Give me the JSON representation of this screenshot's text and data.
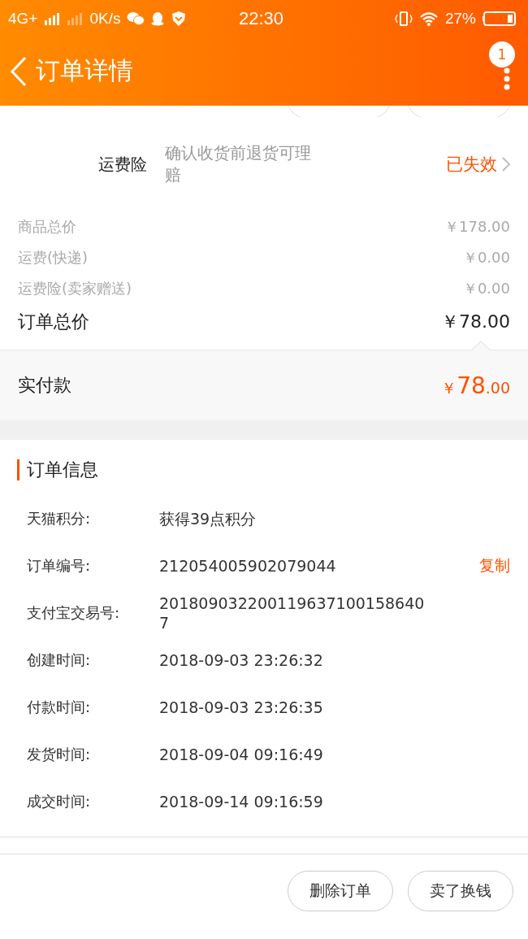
{
  "status_bar": {
    "network": "4G+",
    "speed": "0K/s",
    "time": "22:30",
    "battery": "27%"
  },
  "header": {
    "title": "订单详情",
    "badge": "1"
  },
  "insurance": {
    "label": "运费险",
    "description": "确认收货前退货可理赔",
    "status": "已失效"
  },
  "prices": [
    {
      "label": "商品总价",
      "value": "￥178.00",
      "kind": "minor"
    },
    {
      "label": "运费(快递)",
      "value": "￥0.00",
      "kind": "minor"
    },
    {
      "label": "运费险(卖家赠送)",
      "value": "￥0.00",
      "kind": "minor"
    },
    {
      "label": "订单总价",
      "value": "￥78.00",
      "kind": "total"
    }
  ],
  "paid": {
    "label": "实付款",
    "currency": "￥",
    "integer": "78",
    "decimal": ".00"
  },
  "order_info": {
    "title": "订单信息",
    "rows": [
      {
        "label": "天猫积分:",
        "value": "获得39点积分"
      },
      {
        "label": "订单编号:",
        "value": "212054005902079044",
        "action": "复制"
      },
      {
        "label": "支付宝交易号:",
        "value": "2018090322001196371001586407"
      },
      {
        "label": "创建时间:",
        "value": "2018-09-03 23:26:32"
      },
      {
        "label": "付款时间:",
        "value": "2018-09-03 23:26:35"
      },
      {
        "label": "发货时间:",
        "value": "2018-09-04 09:16:49"
      },
      {
        "label": "成交时间:",
        "value": "2018-09-14 09:16:59"
      }
    ]
  },
  "buttons": [
    "删除订单",
    "卖了换钱"
  ]
}
